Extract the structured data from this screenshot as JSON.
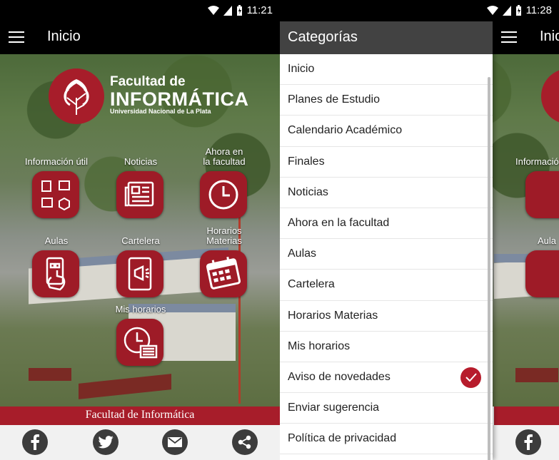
{
  "left": {
    "status_time": "11:21",
    "title": "Inicio",
    "logo": {
      "line1": "Facultad de",
      "line2": "INFORMÁTICA",
      "line3": "Universidad Nacional de La Plata"
    },
    "tiles": [
      {
        "label": "Información útil",
        "icon": "info-grid-icon"
      },
      {
        "label": "Noticias",
        "icon": "newspaper-icon"
      },
      {
        "label": "Ahora en\nla facultad",
        "icon": "clock-icon"
      },
      {
        "label": "Aulas",
        "icon": "phone-touch-icon"
      },
      {
        "label": "Cartelera",
        "icon": "megaphone-tablet-icon"
      },
      {
        "label": "Horarios\nMaterias",
        "icon": "calendar-icon"
      },
      {
        "label": "Mis horarios",
        "icon": "clock-schedule-icon"
      }
    ],
    "footer_text": "Facultad de Informática",
    "social": [
      "facebook-icon",
      "twitter-icon",
      "email-icon",
      "share-icon"
    ]
  },
  "right": {
    "status_time": "11:28",
    "title": "Inic",
    "tiles": [
      {
        "label": "Información"
      },
      {
        "label": "Aula"
      }
    ],
    "drawer": {
      "header": "Categorías",
      "items": [
        "Inicio",
        "Planes de Estudio",
        "Calendario Académico",
        "Finales",
        "Noticias",
        "Ahora en la facultad",
        "Aulas",
        "Cartelera",
        "Horarios Materias",
        "Mis horarios",
        "Aviso de novedades",
        "Enviar sugerencia",
        "Política de privacidad"
      ],
      "checked_item": "Aviso de novedades"
    }
  },
  "colors": {
    "brand_red": "#a71d2a",
    "appbar": "#000000",
    "drawer_header": "#424242"
  }
}
